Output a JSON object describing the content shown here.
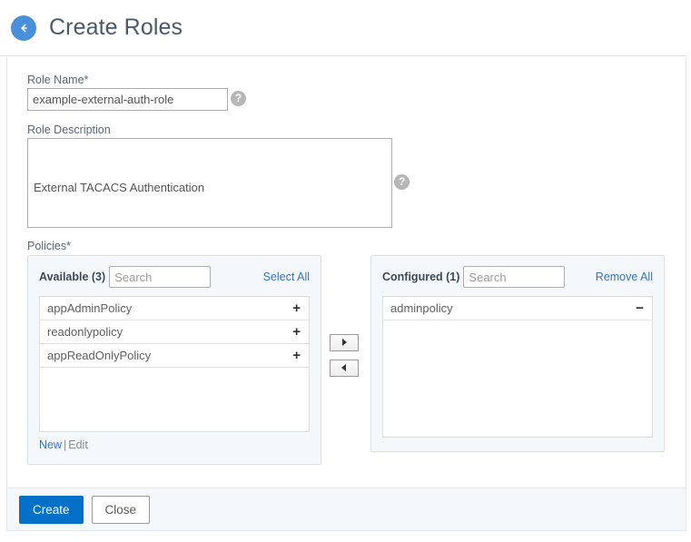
{
  "header": {
    "back_icon": "arrow-left-circle-icon",
    "title": "Create Roles"
  },
  "form": {
    "role_name": {
      "label": "Role Name*",
      "value": "example-external-auth-role",
      "placeholder": "",
      "help_icon": "question-mark-icon"
    },
    "role_description": {
      "label": "Role Description",
      "value": "External TACACS Authentication",
      "placeholder": "",
      "help_icon": "question-mark-icon"
    },
    "policies": {
      "label": "Policies*",
      "available": {
        "title": "Available (3)",
        "search_placeholder": "Search",
        "search_value": "",
        "action_label": "Select All",
        "items": [
          {
            "name": "appAdminPolicy",
            "op": "+"
          },
          {
            "name": "readonlypolicy",
            "op": "+"
          },
          {
            "name": "appReadOnlyPolicy",
            "op": "+"
          }
        ],
        "footer": {
          "new_label": "New",
          "separator": "|",
          "edit_label": "Edit"
        }
      },
      "configured": {
        "title": "Configured (1)",
        "search_placeholder": "Search",
        "search_value": "",
        "action_label": "Remove All",
        "items": [
          {
            "name": "adminpolicy",
            "op": "−"
          }
        ]
      },
      "transfer": {
        "move_right_icon": "triangle-right-icon",
        "move_left_icon": "triangle-left-icon"
      }
    }
  },
  "footer": {
    "create_label": "Create",
    "close_label": "Close"
  },
  "colors": {
    "accent_blue": "#0570c8",
    "back_circle_blue": "#4a90d9",
    "link_blue": "#3b73b9",
    "title_slate": "#4a5a6a",
    "panel_bg": "#f4f8fb",
    "help_gray": "#b6b6b6"
  }
}
